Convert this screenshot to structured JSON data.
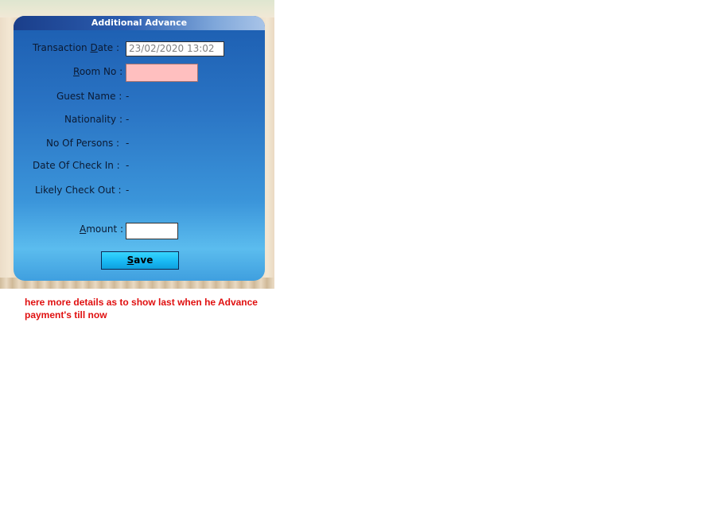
{
  "window": {
    "title": "Additional Advance"
  },
  "form": {
    "transaction_date_label_pre": "Transaction ",
    "transaction_date_label_acc": "D",
    "transaction_date_label_post": "ate :",
    "transaction_date_value": "23/02/2020 13:02",
    "room_no_label_acc": "R",
    "room_no_label_post": "oom No :",
    "room_no_value": "",
    "guest_name_label": "Guest Name :",
    "guest_name_value": "-",
    "nationality_label": "Nationality :",
    "nationality_value": "-",
    "no_of_persons_label": "No Of Persons :",
    "no_of_persons_value": "-",
    "date_of_check_in_label": "Date Of Check In :",
    "date_of_check_in_value": "-",
    "likely_check_out_label": "Likely Check Out :",
    "likely_check_out_value": "-",
    "amount_label_acc": "A",
    "amount_label_post": "mount :",
    "amount_value": "",
    "save_label_acc": "S",
    "save_label_post": "ave"
  },
  "note": {
    "line1": "here more details as to show last when he Advance",
    "line2": "payment's till now"
  },
  "colors": {
    "note": "#e01010",
    "room_input_bg": "#ffbfbf",
    "button": "#17b6f2"
  }
}
